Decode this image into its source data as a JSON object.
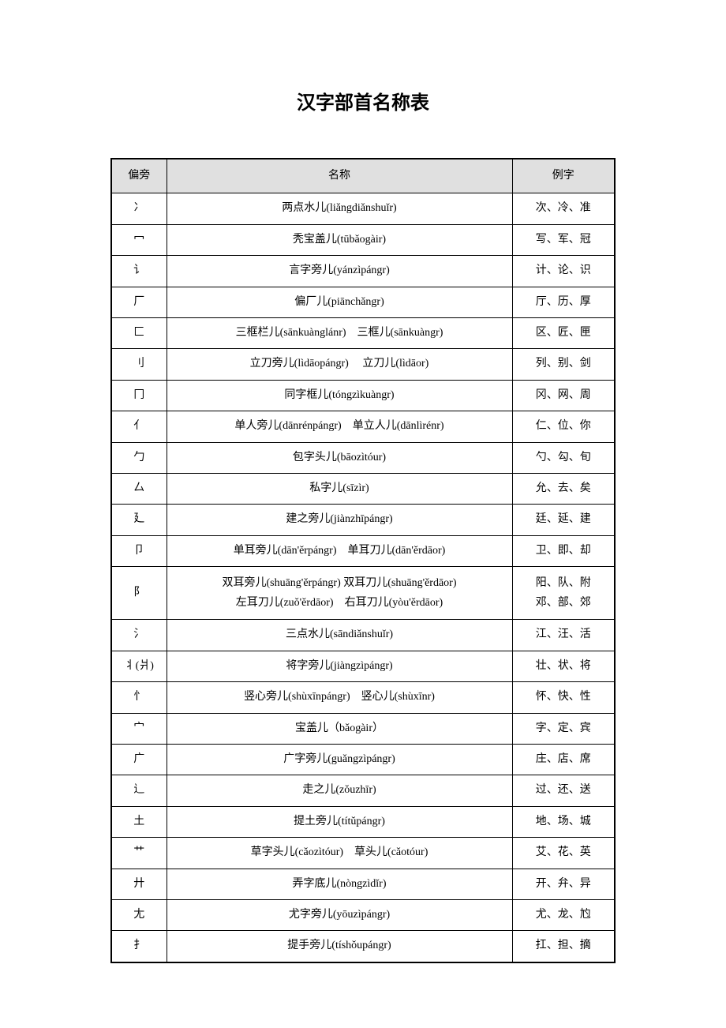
{
  "title": "汉字部首名称表",
  "headers": {
    "radical": "偏旁",
    "name": "名称",
    "example": "例字"
  },
  "rows": [
    {
      "radical": "冫",
      "name": "两点水儿(liǎngdiǎnshuǐr)",
      "example": "次、冷、准"
    },
    {
      "radical": "冖",
      "name": "秃宝盖儿(tūbǎogàir)",
      "example": "写、军、冠"
    },
    {
      "radical": "讠",
      "name": "言字旁儿(yánzìpángr)",
      "example": "计、论、识"
    },
    {
      "radical": "厂",
      "name": "偏厂儿(piānchǎngr)",
      "example": "厅、历、厚"
    },
    {
      "radical": "匚",
      "name": "三框栏儿(sānkuànglánr)　三框儿(sānkuàngr)",
      "example": "区、匠、匣"
    },
    {
      "radical": "刂",
      "name": "立刀旁儿(lìdāopángr)　 立刀儿(lìdāor)",
      "example": "列、别、剑"
    },
    {
      "radical": "冂",
      "name": "同字框儿(tóngzìkuàngr)",
      "example": "冈、网、周"
    },
    {
      "radical": "亻",
      "name": "单人旁儿(dānrénpángr)　单立人儿(dānlìrénr)",
      "example": "仁、位、你"
    },
    {
      "radical": "勹",
      "name": "包字头儿(bāozìtóur)",
      "example": "勺、勾、旬"
    },
    {
      "radical": "厶",
      "name": "私字儿(sīzìr)",
      "example": "允、去、矣"
    },
    {
      "radical": "廴",
      "name": "建之旁儿(jiànzhīpángr)",
      "example": "廷、延、建"
    },
    {
      "radical": "卩",
      "name": "单耳旁儿(dān'ěrpángr)　单耳刀儿(dān'ěrdāor)",
      "example": "卫、即、却"
    },
    {
      "radical": "阝",
      "name": "双耳旁儿(shuāng'ěrpángr) 双耳刀儿(shuāng'ěrdāor)\n左耳刀儿(zuǒ'ěrdāor)　右耳刀儿(yòu'ěrdāor)",
      "example": "阳、队、附\n邓、部、郊"
    },
    {
      "radical": "氵",
      "name": "三点水儿(sāndiǎnshuǐr)",
      "example": "江、汪、活"
    },
    {
      "radical": "丬(爿)",
      "name": "将字旁儿(jiàngzìpángr)",
      "example": "壮、状、将"
    },
    {
      "radical": "忄",
      "name": "竖心旁儿(shùxīnpángr)　竖心儿(shùxīnr)",
      "example": "怀、快、性"
    },
    {
      "radical": "宀",
      "name": "宝盖儿（bǎogàir）",
      "example": "字、定、宾"
    },
    {
      "radical": "广",
      "name": "广字旁儿(guǎngzìpángr)",
      "example": "庄、店、席"
    },
    {
      "radical": "辶",
      "name": "走之儿(zǒuzhīr)",
      "example": "过、还、送"
    },
    {
      "radical": "土",
      "name": "提土旁儿(títǔpángr)",
      "example": "地、场、城"
    },
    {
      "radical": "艹",
      "name": "草字头儿(cǎozìtóur)　草头儿(cǎotóur)",
      "example": "艾、花、英"
    },
    {
      "radical": "廾",
      "name": "弄字底儿(nòngzìdǐr)",
      "example": "开、弁、异"
    },
    {
      "radical": "尢",
      "name": "尤字旁儿(yōuzìpángr)",
      "example": "尤、龙、尥"
    },
    {
      "radical": "扌",
      "name": "提手旁儿(tíshǒupángr)",
      "example": "扛、担、摘"
    }
  ]
}
